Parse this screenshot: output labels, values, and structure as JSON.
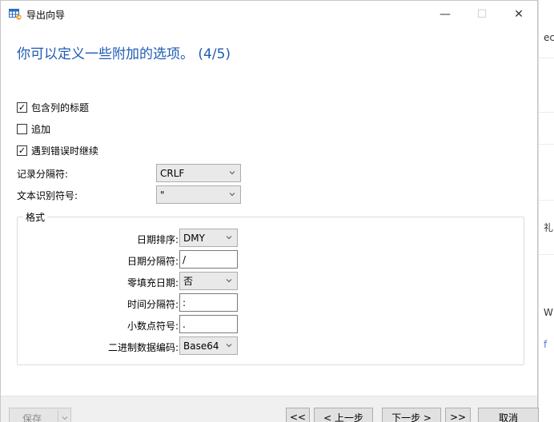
{
  "window": {
    "title": "导出向导",
    "minimize_glyph": "—",
    "maximize_glyph": "☐",
    "close_glyph": "✕"
  },
  "heading": "你可以定义一些附加的选项。 (4/5)",
  "options": {
    "include_headers": {
      "label": "包含列的标题",
      "checked": true,
      "mark": "✓"
    },
    "append": {
      "label": "追加",
      "checked": false,
      "mark": ""
    },
    "continue_on_error": {
      "label": "遇到错误时继续",
      "checked": true,
      "mark": "✓"
    }
  },
  "record_delimiter": {
    "label": "记录分隔符:",
    "value": "CRLF"
  },
  "text_qualifier": {
    "label": "文本识别符号:",
    "value": "\""
  },
  "format": {
    "title": "格式",
    "date_order": {
      "label": "日期排序:",
      "value": "DMY"
    },
    "date_delimiter": {
      "label": "日期分隔符:",
      "value": "/"
    },
    "zero_padding_date": {
      "label": "零填充日期:",
      "value": "否"
    },
    "time_delimiter": {
      "label": "时间分隔符:",
      "value": ":"
    },
    "decimal_symbol": {
      "label": "小数点符号:",
      "value": "."
    },
    "binary_encoding": {
      "label": "二进制数据编码:",
      "value": "Base64"
    }
  },
  "footer": {
    "save_label": "保存",
    "first_label": "<<",
    "prev_label": "< 上一步",
    "next_label": "下一步 >",
    "last_label": ">>",
    "cancel_label": "取消"
  },
  "background": {
    "text_1": "ec",
    "text_2": "礼",
    "text_3": "W",
    "text_4": "f"
  },
  "colors": {
    "heading": "#1f5bb3",
    "footer_bg": "#f0f0f0"
  }
}
